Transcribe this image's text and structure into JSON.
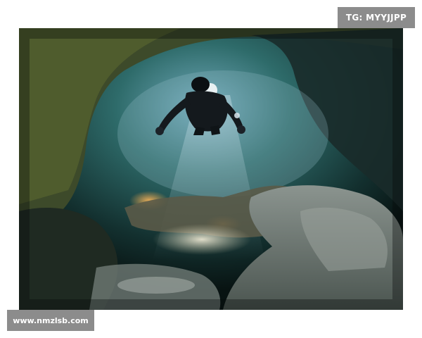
{
  "watermarks": {
    "top_right": "TG: MYYJJPP",
    "bottom_left": "www.nmzlsb.com"
  },
  "photo": {
    "colors": {
      "background": "#ffffff",
      "water_dark": "#0d1a1a",
      "water_teal": "#2e6b6a",
      "light_beam": "#bcd8e6",
      "rock_green": "#3d4a2a",
      "rock_grey": "#6f7a75",
      "torch_glow": "#e8a14a",
      "watermark_bg": "#8c8c8c"
    }
  }
}
